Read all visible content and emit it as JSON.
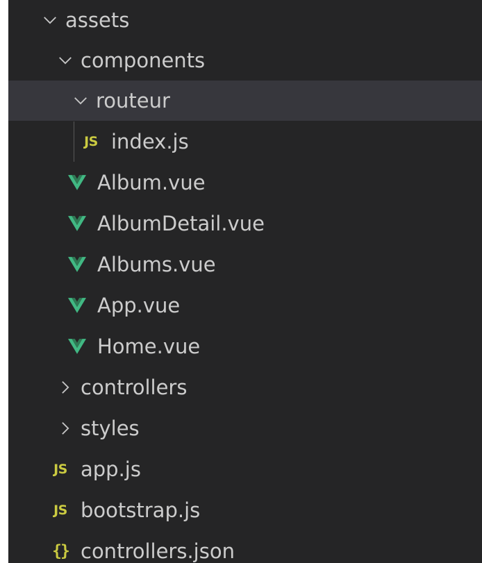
{
  "explorer": {
    "items": [
      {
        "label": "assets",
        "kind": "folder",
        "expanded": true
      },
      {
        "label": "components",
        "kind": "folder",
        "expanded": true
      },
      {
        "label": "routeur",
        "kind": "folder",
        "expanded": true,
        "selected": true
      },
      {
        "label": "index.js",
        "kind": "js"
      },
      {
        "label": "Album.vue",
        "kind": "vue"
      },
      {
        "label": "AlbumDetail.vue",
        "kind": "vue"
      },
      {
        "label": "Albums.vue",
        "kind": "vue"
      },
      {
        "label": "App.vue",
        "kind": "vue"
      },
      {
        "label": "Home.vue",
        "kind": "vue"
      },
      {
        "label": "controllers",
        "kind": "folder",
        "expanded": false
      },
      {
        "label": "styles",
        "kind": "folder",
        "expanded": false
      },
      {
        "label": "app.js",
        "kind": "js"
      },
      {
        "label": "bootstrap.js",
        "kind": "js"
      },
      {
        "label": "controllers.json",
        "kind": "json"
      }
    ],
    "icons": {
      "js_badge": "JS",
      "json_badge": "{}"
    },
    "colors": {
      "background": "#252526",
      "selected_row": "#37373d",
      "text": "#cccccc",
      "vue_green": "#41b883",
      "js_yellow": "#cbcb41"
    }
  }
}
